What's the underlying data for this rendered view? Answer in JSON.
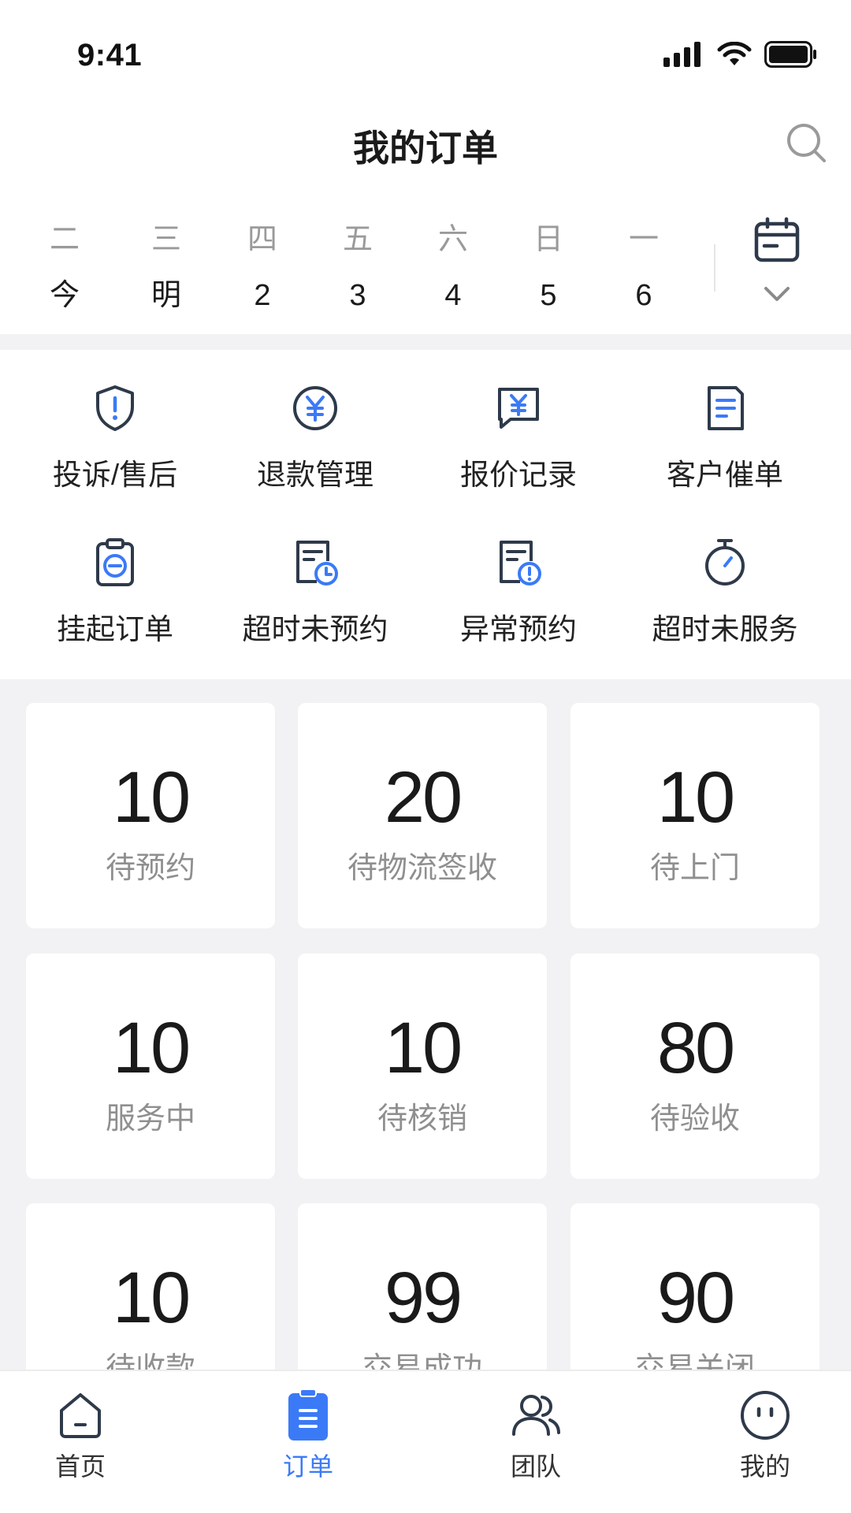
{
  "status_bar": {
    "time": "9:41"
  },
  "header": {
    "title": "我的订单"
  },
  "date_strip": {
    "days": [
      {
        "weekday": "二",
        "day": "今"
      },
      {
        "weekday": "三",
        "day": "明"
      },
      {
        "weekday": "四",
        "day": "2"
      },
      {
        "weekday": "五",
        "day": "3"
      },
      {
        "weekday": "六",
        "day": "4"
      },
      {
        "weekday": "日",
        "day": "5"
      },
      {
        "weekday": "一",
        "day": "6"
      }
    ]
  },
  "quick_entries": [
    {
      "label": "投诉/售后",
      "icon": "shield-alert-icon"
    },
    {
      "label": "退款管理",
      "icon": "yen-circle-icon"
    },
    {
      "label": "报价记录",
      "icon": "yen-chat-icon"
    },
    {
      "label": "客户催单",
      "icon": "document-icon"
    },
    {
      "label": "挂起订单",
      "icon": "clipboard-minus-icon"
    },
    {
      "label": "超时未预约",
      "icon": "doc-clock-icon"
    },
    {
      "label": "异常预约",
      "icon": "doc-alert-icon"
    },
    {
      "label": "超时未服务",
      "icon": "stopwatch-icon"
    }
  ],
  "stats": [
    {
      "value": "10",
      "label": "待预约"
    },
    {
      "value": "20",
      "label": "待物流签收"
    },
    {
      "value": "10",
      "label": "待上门"
    },
    {
      "value": "10",
      "label": "服务中"
    },
    {
      "value": "10",
      "label": "待核销"
    },
    {
      "value": "80",
      "label": "待验收"
    },
    {
      "value": "10",
      "label": "待收款"
    },
    {
      "value": "99",
      "label": "交易成功"
    },
    {
      "value": "90",
      "label": "交易关闭"
    }
  ],
  "tab_bar": {
    "items": [
      {
        "label": "首页",
        "icon": "home-icon"
      },
      {
        "label": "订单",
        "icon": "order-icon",
        "active": true
      },
      {
        "label": "团队",
        "icon": "team-icon"
      },
      {
        "label": "我的",
        "icon": "profile-icon"
      }
    ]
  },
  "colors": {
    "accent": "#3B7AF7",
    "icon_dark": "#2E3A4A",
    "background_gray": "#F2F2F4"
  }
}
